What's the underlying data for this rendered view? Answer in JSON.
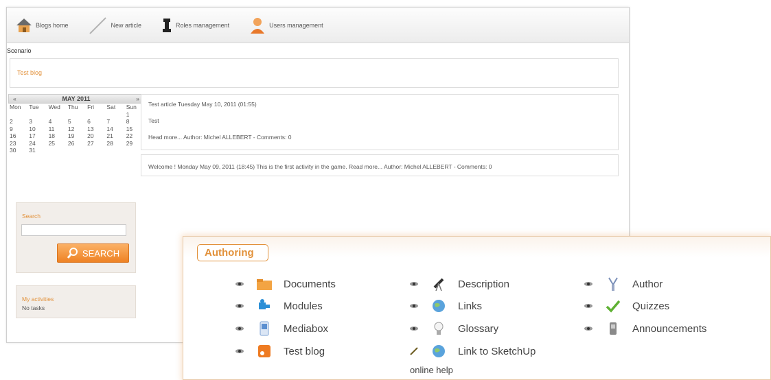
{
  "nav": {
    "blogs_home": "Blogs home",
    "new_article": "New article",
    "roles_management": "Roles management",
    "users_management": "Users management"
  },
  "scenario_label": "Scenario",
  "blog_title": "Test blog",
  "calendar": {
    "prev": "«",
    "month": "MAY 2011",
    "next": "»",
    "days": [
      "Mon",
      "Tue",
      "Wed",
      "Thu",
      "Fri",
      "Sat",
      "Sun"
    ],
    "weeks": [
      [
        "",
        "",
        "",
        "",
        "",
        "",
        "1"
      ],
      [
        "2",
        "3",
        "4",
        "5",
        "6",
        "7",
        "8"
      ],
      [
        "9",
        "10",
        "11",
        "12",
        "13",
        "14",
        "15"
      ],
      [
        "16",
        "17",
        "18",
        "19",
        "20",
        "21",
        "22"
      ],
      [
        "23",
        "24",
        "25",
        "26",
        "27",
        "28",
        "29"
      ],
      [
        "30",
        "31",
        "",
        "",
        "",
        "",
        ""
      ]
    ]
  },
  "search": {
    "label": "Search",
    "button": "SEARCH"
  },
  "activities": {
    "label": "My activities",
    "empty": "No tasks"
  },
  "articles": [
    {
      "heading": "Test article Tuesday May 10, 2011 (01:55)",
      "body": "Test",
      "footer": "Head more... Author: Michel ALLEBERT - Comments: 0"
    },
    {
      "line": "Welcome ! Monday May 09, 2011 (18:45) This is the first activity in the game. Read more... Author: Michel ALLEBERT - Comments: 0"
    }
  ],
  "authoring": {
    "tab": "Authoring",
    "tools": {
      "documents": "Documents",
      "modules": "Modules",
      "mediabox": "Mediabox",
      "test_blog": "Test blog",
      "description": "Description",
      "links": "Links",
      "glossary": "Glossary",
      "link_sketchup": "Link to SketchUp",
      "author": "Author",
      "quizzes": "Quizzes",
      "announcements": "Announcements"
    },
    "online_help": "online help"
  },
  "colors": {
    "accent": "#e2913a",
    "search_button": "#ee8224"
  }
}
